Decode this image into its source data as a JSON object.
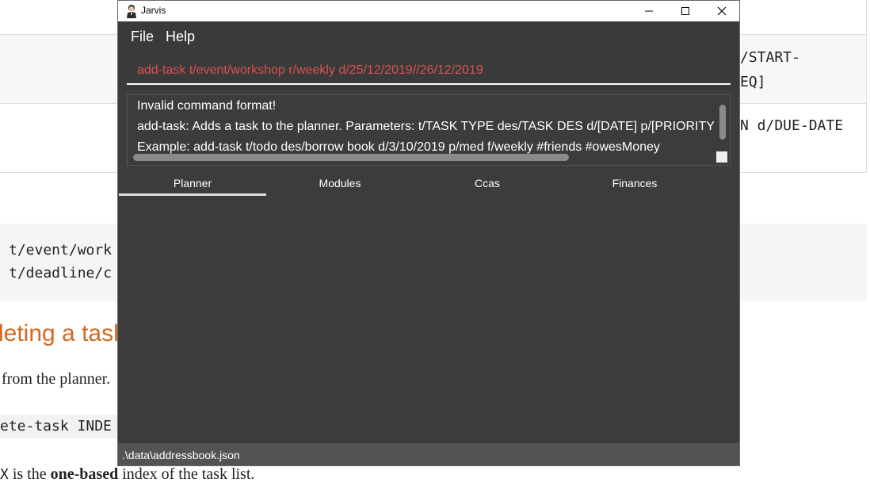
{
  "doc": {
    "row2_right_line1": "/START-",
    "row2_right_line2": "EQ]",
    "row3_right": "N d/DUE-DATE",
    "code_line1": "t/event/work",
    "code_line2": "t/deadline/c",
    "heading": "leting a task",
    "para1": "from the planner.",
    "inline_code": "ete-task INDE",
    "para2_prefix": "X",
    "para2_mid": " is the ",
    "para2_bold": "one-based",
    "para2_suffix": " index of the task list."
  },
  "window": {
    "title": "Jarvis",
    "menu": {
      "file": "File",
      "help": "Help"
    },
    "command_input": {
      "value": "add-task t/event/workshop r/weekly d/25/12/2019//26/12/2019"
    },
    "result": {
      "line1": "Invalid command format!",
      "line2": "add-task: Adds a task to the planner. Parameters: t/TASK TYPE des/TASK DES d/[DATE] p/[PRIORITY L",
      "line3": "Example: add-task t/todo des/borrow book d/3/10/2019 p/med f/weekly #friends #owesMoney"
    },
    "tabs": [
      "Planner",
      "Modules",
      "Ccas",
      "Finances"
    ],
    "active_tab": "Planner",
    "status": ".\\data\\addressbook.json"
  }
}
